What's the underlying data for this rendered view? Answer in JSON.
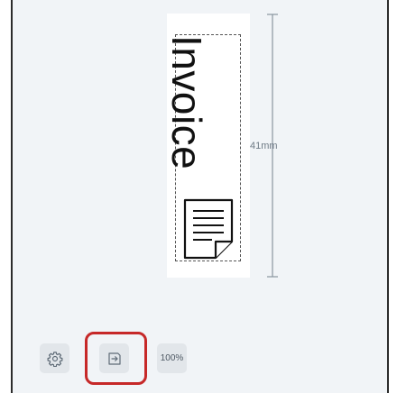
{
  "canvas": {
    "label_text": "Invoice",
    "dimension_label": "41mm",
    "icons": {
      "document": "document-icon",
      "settings": "gear-icon",
      "export": "export-icon"
    }
  },
  "toolbar": {
    "zoom_label": "100%"
  },
  "colors": {
    "canvas_bg": "#f1f4f7",
    "button_bg": "#e2e6ea",
    "highlight": "#c62828",
    "dimension": "#6f7b86"
  }
}
